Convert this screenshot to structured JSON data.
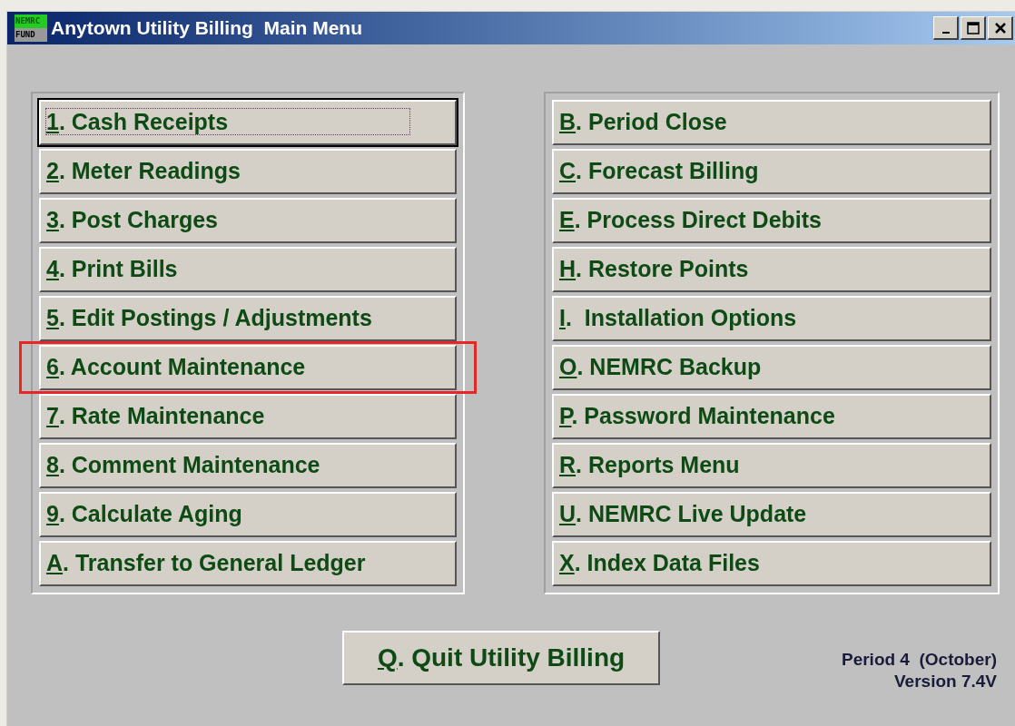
{
  "window": {
    "title": "Anytown Utility Billing  Main Menu",
    "logo_top": "NEMRC",
    "logo_bottom": "FUND"
  },
  "left_menu": [
    {
      "key": "1",
      "rest": ". Cash Receipts",
      "focused": true,
      "highlighted": false
    },
    {
      "key": "2",
      "rest": ". Meter Readings",
      "focused": false,
      "highlighted": false
    },
    {
      "key": "3",
      "rest": ". Post Charges",
      "focused": false,
      "highlighted": false
    },
    {
      "key": "4",
      "rest": ". Print Bills",
      "focused": false,
      "highlighted": false
    },
    {
      "key": "5",
      "rest": ". Edit Postings / Adjustments",
      "focused": false,
      "highlighted": false
    },
    {
      "key": "6",
      "rest": ". Account Maintenance",
      "focused": false,
      "highlighted": true
    },
    {
      "key": "7",
      "rest": ". Rate Maintenance",
      "focused": false,
      "highlighted": false
    },
    {
      "key": "8",
      "rest": ". Comment Maintenance",
      "focused": false,
      "highlighted": false
    },
    {
      "key": "9",
      "rest": ". Calculate Aging",
      "focused": false,
      "highlighted": false
    },
    {
      "key": "A",
      "rest": ". Transfer to General Ledger",
      "focused": false,
      "highlighted": false
    }
  ],
  "right_menu": [
    {
      "key": "B",
      "rest": ". Period Close",
      "focused": false,
      "highlighted": false
    },
    {
      "key": "C",
      "rest": ". Forecast Billing",
      "focused": false,
      "highlighted": false
    },
    {
      "key": "E",
      "rest": ". Process Direct Debits",
      "focused": false,
      "highlighted": false
    },
    {
      "key": "H",
      "rest": ". Restore Points",
      "focused": false,
      "highlighted": false
    },
    {
      "key": "I",
      "rest": ".  Installation Options",
      "focused": false,
      "highlighted": false
    },
    {
      "key": "O",
      "rest": ". NEMRC Backup",
      "focused": false,
      "highlighted": false
    },
    {
      "key": "P",
      "rest": ". Password Maintenance",
      "focused": false,
      "highlighted": false
    },
    {
      "key": "R",
      "rest": ". Reports Menu",
      "focused": false,
      "highlighted": false
    },
    {
      "key": "U",
      "rest": ". NEMRC Live Update",
      "focused": false,
      "highlighted": false
    },
    {
      "key": "X",
      "rest": ". Index Data Files",
      "focused": false,
      "highlighted": false
    }
  ],
  "quit": {
    "key": "Q",
    "rest": ". Quit Utility Billing"
  },
  "status": {
    "period": "Period 4  (October)",
    "version": "Version 7.4V"
  }
}
